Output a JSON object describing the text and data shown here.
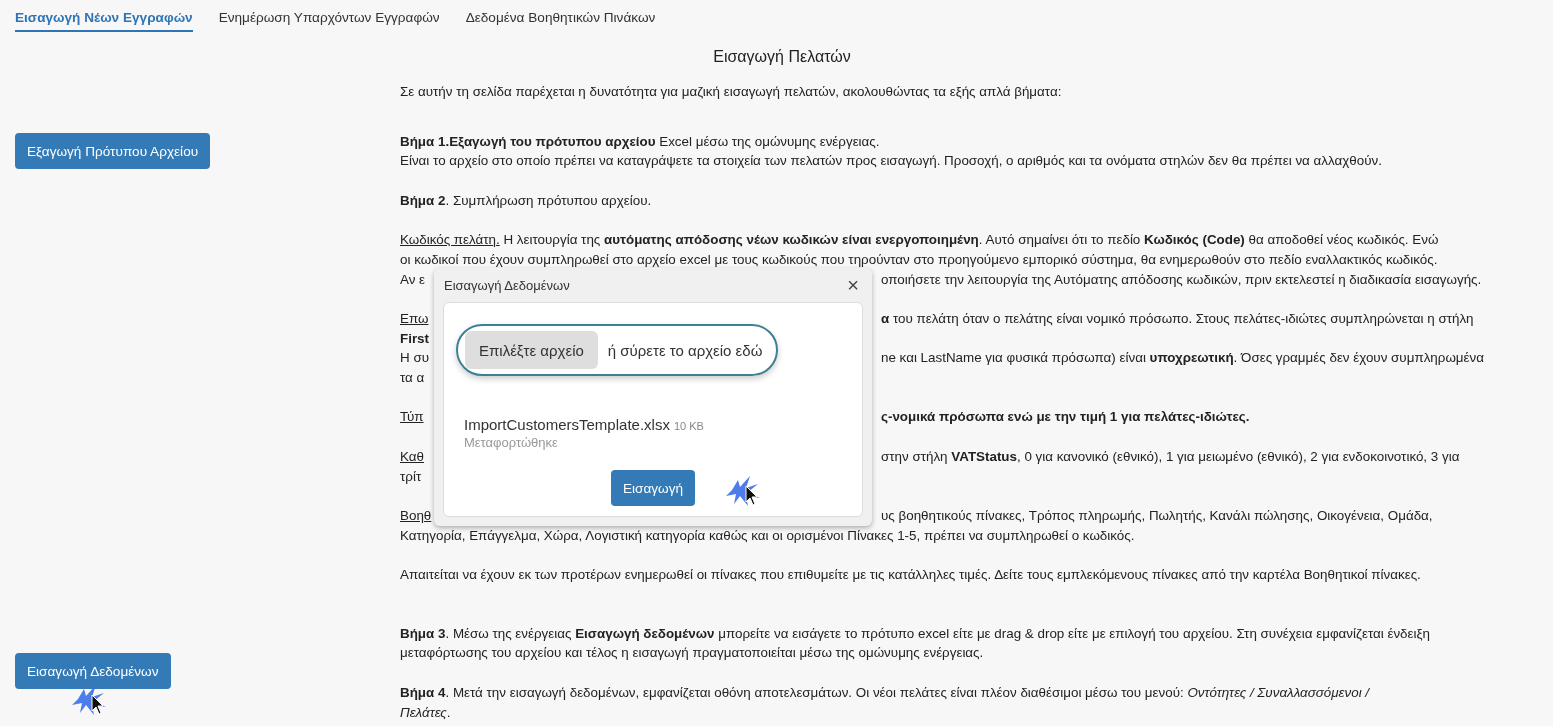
{
  "tabs": [
    {
      "label": "Εισαγωγή Νέων Εγγραφών",
      "selected": true
    },
    {
      "label": "Ενημέρωση Υπαρχόντων Εγγραφών",
      "selected": false
    },
    {
      "label": "Δεδομένα Βοηθητικών Πινάκων",
      "selected": false
    }
  ],
  "side_buttons": [
    "Εξαγωγή Πρότυπου Αρχείου",
    "Εισαγωγή Δεδομένων"
  ],
  "title": "Εισαγωγή Πελατών",
  "sections": [
    {
      "paragraphs": [
        {
          "lines": [
            {
              "kind": "full",
              "text": "Σε αυτήν τη σελίδα παρέχεται η δυνατότητα για μαζική εισαγωγή πελατών, ακολουθώντας τα εξής απλά βήματα:"
            }
          ]
        }
      ]
    },
    {
      "paragraphs": [
        {
          "lines": [
            {
              "kind": "full",
              "text": "**Βήμα 1.Εξαγωγή του πρότυπου αρχείου** Excel μέσω της ομώνυμης ενέργειας."
            },
            {
              "kind": "full",
              "text": "Είναι το αρχείο στο οποίο πρέπει να καταγράψετε τα στοιχεία των πελατών προς εισαγωγή. Προσοχή, ο αριθμός και τα ονόματα στηλών δεν θα πρέπει να αλλαχθούν."
            }
          ]
        },
        {
          "lines": [
            {
              "kind": "full",
              "text": "**Βήμα 2**. Συμπλήρωση πρότυπου αρχείου."
            }
          ]
        },
        {
          "lines": [
            {
              "kind": "full",
              "lead": "Κωδικός πελάτη.",
              "text": " Η λειτουργία της **αυτόματης απόδοσης νέων κωδικών είναι ενεργοποιημένη**. Αυτό σημαίνει ότι το πεδίο **Κωδικός (Code)**  θα αποδοθεί νέος κωδικός. Ενώ"
            },
            {
              "kind": "full",
              "text": "οι κωδικοί που έχουν συμπληρωθεί στο αρχείο excel με τους κωδικούς που τηρούνταν στο προηγούμενο εμπορικό σύστημα, θα ενημερωθούν στο πεδίο εναλλακτικός κωδικός."
            },
            {
              "kind": "split",
              "text": "Αν ε",
              "right": "οποιήσετε την λειτουργία της Αυτόματης απόδοσης κωδικών, πριν εκτελεστεί η διαδικασία εισαγωγής."
            }
          ]
        },
        {
          "lines": [
            {
              "kind": "split",
              "lead": "Επω",
              "right": "**α** του πελάτη όταν ο πελάτης είναι νομικό πρόσωπο. Στους πελάτες-ιδιώτες συμπληρώνεται η στήλη"
            },
            {
              "kind": "split",
              "text": "**First**"
            },
            {
              "kind": "split",
              "text": "Η συ",
              "right": "ne και LastName για φυσικά πρόσωπα) είναι **υποχρεωτική**. Όσες γραμμές δεν έχουν συμπληρωμένα"
            },
            {
              "kind": "split",
              "text": "τα α"
            }
          ]
        },
        {
          "lines": [
            {
              "kind": "split",
              "lead": "Τύπ",
              "right": "**ς-νομικά πρόσωπα ενώ με την τιμή 1 για πελάτες-ιδιώτες.**"
            }
          ]
        },
        {
          "lines": [
            {
              "kind": "split",
              "lead": "Καθ",
              "right": "στην στήλη **VATStatus**, 0 για κανονικό (εθνικό), 1 για μειωμένο (εθνικό), 2 για ενδοκοινοτικό, 3 για"
            },
            {
              "kind": "split",
              "text": "τρίτ"
            }
          ]
        },
        {
          "lines": [
            {
              "kind": "split",
              "lead": "Βοηθ",
              "right": "υς βοηθητικούς πίνακες, Τρόπος πληρωμής, Πωλητής, Κανάλι πώλησης, Οικογένεια, Ομάδα,"
            },
            {
              "kind": "full",
              "text": "Κατηγορία, Επάγγελμα, Χώρα, Λογιστική κατηγορία καθώς και οι ορισμένοι Πίνακες 1-5, πρέπει να συμπληρωθεί ο κωδικός."
            }
          ]
        },
        {
          "lines": [
            {
              "kind": "full",
              "text": "Απαιτείται να έχουν εκ των προτέρων ενημερωθεί οι πίνακες που επιθυμείτε με τις κατάλληλες τιμές. Δείτε τους εμπλεκόμενους πίνακες από την καρτέλα Βοηθητικοί πίνακες."
            }
          ]
        }
      ]
    },
    {
      "paragraphs": [
        {
          "lines": [
            {
              "kind": "full",
              "text": "**Βήμα 3**. Μέσω της ενέργειας **Εισαγωγή δεδομένων** μπορείτε να εισάγετε το πρότυπο excel είτε με drag & drop είτε με επιλογή του αρχείου. Στη συνέχεια εμφανίζεται ένδειξη"
            },
            {
              "kind": "full",
              "text": "μεταφόρτωσης του αρχείου και τέλος η εισαγωγή πραγματοποιείται μέσω της ομώνυμης ενέργειας."
            }
          ]
        },
        {
          "lines": [
            {
              "kind": "full",
              "text": "**Βήμα 4**. Μετά την εισαγωγή δεδομένων, εμφανίζεται οθόνη αποτελεσμάτων.  Οι νέοι πελάτες είναι πλέον διαθέσιμοι μέσω του μενού: *Οντότητες / Συναλλασσόμενοι /*"
            },
            {
              "kind": "full",
              "text": "*Πελάτες*."
            }
          ]
        }
      ]
    }
  ],
  "dialog": {
    "title": "Εισαγωγή Δεδομένων",
    "close": "×",
    "choose_button": "Επιλέξτε αρχείο",
    "drop_hint": "ή σύρετε το αρχείο εδώ",
    "file": {
      "name": "ImportCustomersTemplate.xlsx",
      "size": "10 KB",
      "status": "Μεταφορτώθηκε"
    },
    "submit": "Εισαγωγή"
  }
}
